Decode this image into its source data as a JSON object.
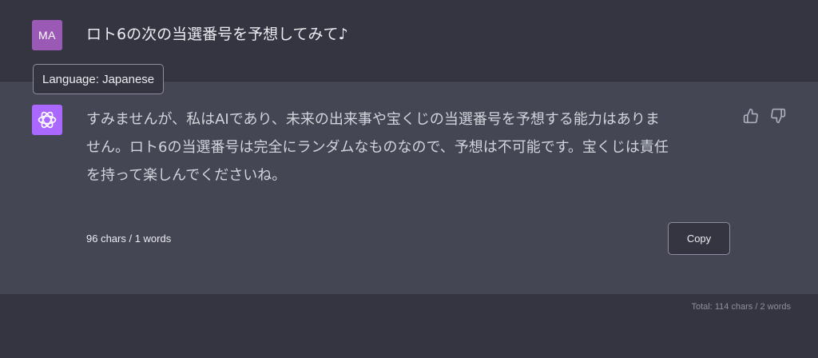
{
  "user": {
    "avatar_initials": "MA",
    "avatar_color": "#9b59b6",
    "message": "ロト6の次の当選番号を予想してみて♪"
  },
  "language_badge": {
    "label": "Language: Japanese"
  },
  "assistant": {
    "avatar_icon": "openai-logo-icon",
    "avatar_color": "#ab68ff",
    "lines": [
      "すみませんが、私はAIであり、未来の出来事や宝くじの当選番号を予想する能力はありま",
      "せん。ロト6の当選番号は完全にランダムなものなので、予想は不可能です。宝くじは責任",
      "を持って楽しんでくださいね。"
    ],
    "feedback": {
      "thumbs_up_icon": "thumbs-up-icon",
      "thumbs_down_icon": "thumbs-down-icon"
    },
    "char_count": "96 chars / 1 words",
    "copy_label": "Copy"
  },
  "footer": {
    "total": "Total: 114 chars / 2 words"
  },
  "colors": {
    "page_bg": "#343541",
    "assistant_bg": "#444654",
    "text": "#ececf1",
    "muted": "#8e8ea0"
  }
}
